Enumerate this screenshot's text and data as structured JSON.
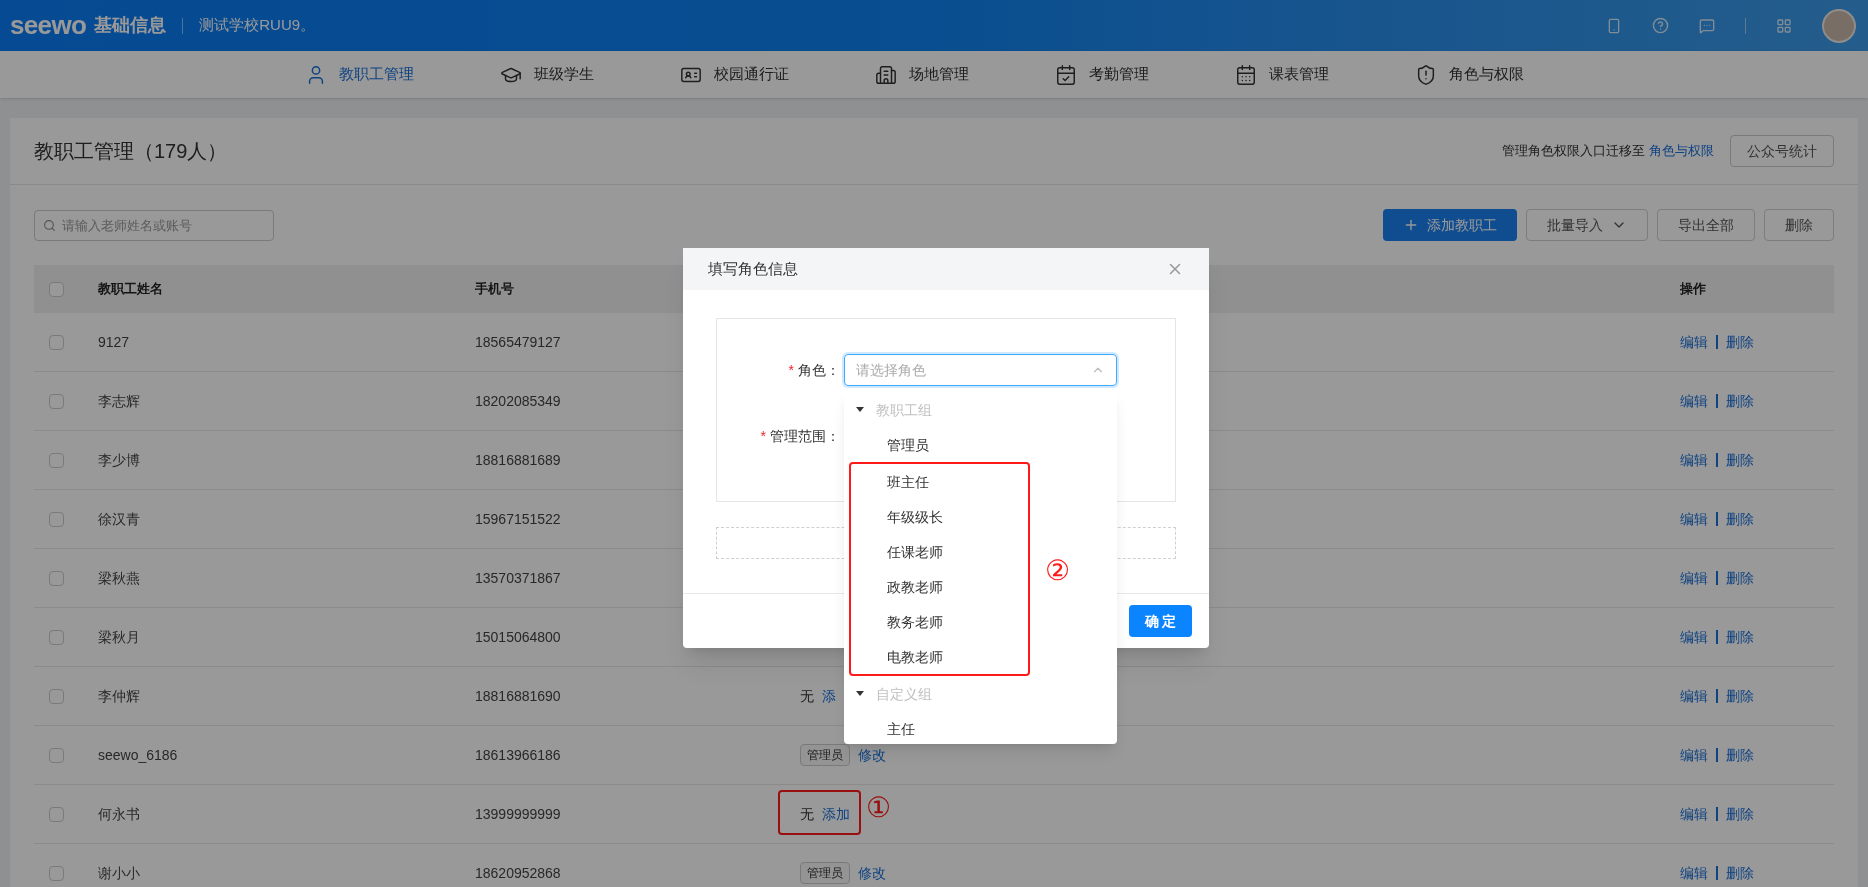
{
  "header": {
    "logo": "seewo",
    "app_name": "基础信息",
    "school": "测试学校RUU9。"
  },
  "nav": [
    {
      "label": "教职工管理",
      "selected": true
    },
    {
      "label": "班级学生",
      "selected": false
    },
    {
      "label": "校园通行证",
      "selected": false
    },
    {
      "label": "场地管理",
      "selected": false
    },
    {
      "label": "考勤管理",
      "selected": false
    },
    {
      "label": "课表管理",
      "selected": false
    },
    {
      "label": "角色与权限",
      "selected": false
    }
  ],
  "page": {
    "title": "教职工管理（179人）",
    "notice": "管理角色权限入口迁移至",
    "notice_link": "角色与权限",
    "stats_button": "公众号统计",
    "search": {
      "placeholder": "请输入老师姓名或账号"
    },
    "buttons": [
      {
        "label": "添加教职工",
        "kind": "primary"
      },
      {
        "label": "批量导入",
        "kind": "dropdown"
      },
      {
        "label": "导出全部",
        "kind": "default"
      },
      {
        "label": "删除",
        "kind": "default"
      }
    ]
  },
  "table": {
    "select_all": {
      "checked": false
    },
    "columns": [
      "教职工姓名",
      "手机号",
      "操作"
    ],
    "rows": [
      {
        "checked": false,
        "name": "9127",
        "phone": "18565479127",
        "actions": [
          "编辑",
          "删除"
        ]
      },
      {
        "checked": false,
        "name": "李志辉",
        "phone": "18202085349",
        "actions": [
          "编辑",
          "删除"
        ]
      },
      {
        "checked": false,
        "name": "李少博",
        "phone": "18816881689",
        "actions": [
          "编辑",
          "删除"
        ]
      },
      {
        "checked": false,
        "name": "徐汉青",
        "phone": "15967151522",
        "actions": [
          "编辑",
          "删除"
        ]
      },
      {
        "checked": false,
        "name": "梁秋燕",
        "phone": "13570371867",
        "actions": [
          "编辑",
          "删除"
        ]
      },
      {
        "checked": false,
        "name": "梁秋月",
        "phone": "15015064800",
        "actions": [
          "编辑",
          "删除"
        ]
      },
      {
        "checked": false,
        "name": "李仲辉",
        "phone": "18816881690",
        "role": {
          "kind": "none",
          "text": "无",
          "link": "添"
        },
        "actions": [
          "编辑",
          "删除"
        ]
      },
      {
        "checked": false,
        "name": "seewo_6186",
        "phone": "18613966186",
        "role": {
          "kind": "tag",
          "text": "管理员",
          "link": "修改"
        },
        "actions": [
          "编辑",
          "删除"
        ]
      },
      {
        "checked": false,
        "name": "何永书",
        "phone": "13999999999",
        "role": {
          "kind": "none",
          "text": "无",
          "link": "添加"
        },
        "annotation": "①",
        "actions": [
          "编辑",
          "删除"
        ]
      },
      {
        "checked": false,
        "name": "谢小小",
        "phone": "18620952868",
        "role": {
          "kind": "tag",
          "text": "管理员",
          "link": "修改"
        },
        "actions": [
          "编辑",
          "删除"
        ]
      }
    ]
  },
  "dialog": {
    "title": "填写角色信息",
    "fields": [
      {
        "required_mark": "*",
        "label": "角色：",
        "placeholder": "请选择角色"
      },
      {
        "required_mark": "*",
        "label": "管理范围："
      }
    ],
    "confirm": "确 定"
  },
  "dropdown": {
    "annotation": "②",
    "groups": [
      {
        "label": "教职工组",
        "expanded": true,
        "children": [
          {
            "label": "管理员",
            "annotated": false
          },
          {
            "label": "班主任",
            "annotated": true
          },
          {
            "label": "年级级长",
            "annotated": true
          },
          {
            "label": "任课老师",
            "annotated": true
          },
          {
            "label": "政教老师",
            "annotated": true
          },
          {
            "label": "教务老师",
            "annotated": true
          },
          {
            "label": "电教老师",
            "annotated": true
          }
        ]
      },
      {
        "label": "自定义组",
        "expanded": true,
        "children": [
          {
            "label": "主任",
            "annotated": false
          }
        ]
      }
    ]
  }
}
